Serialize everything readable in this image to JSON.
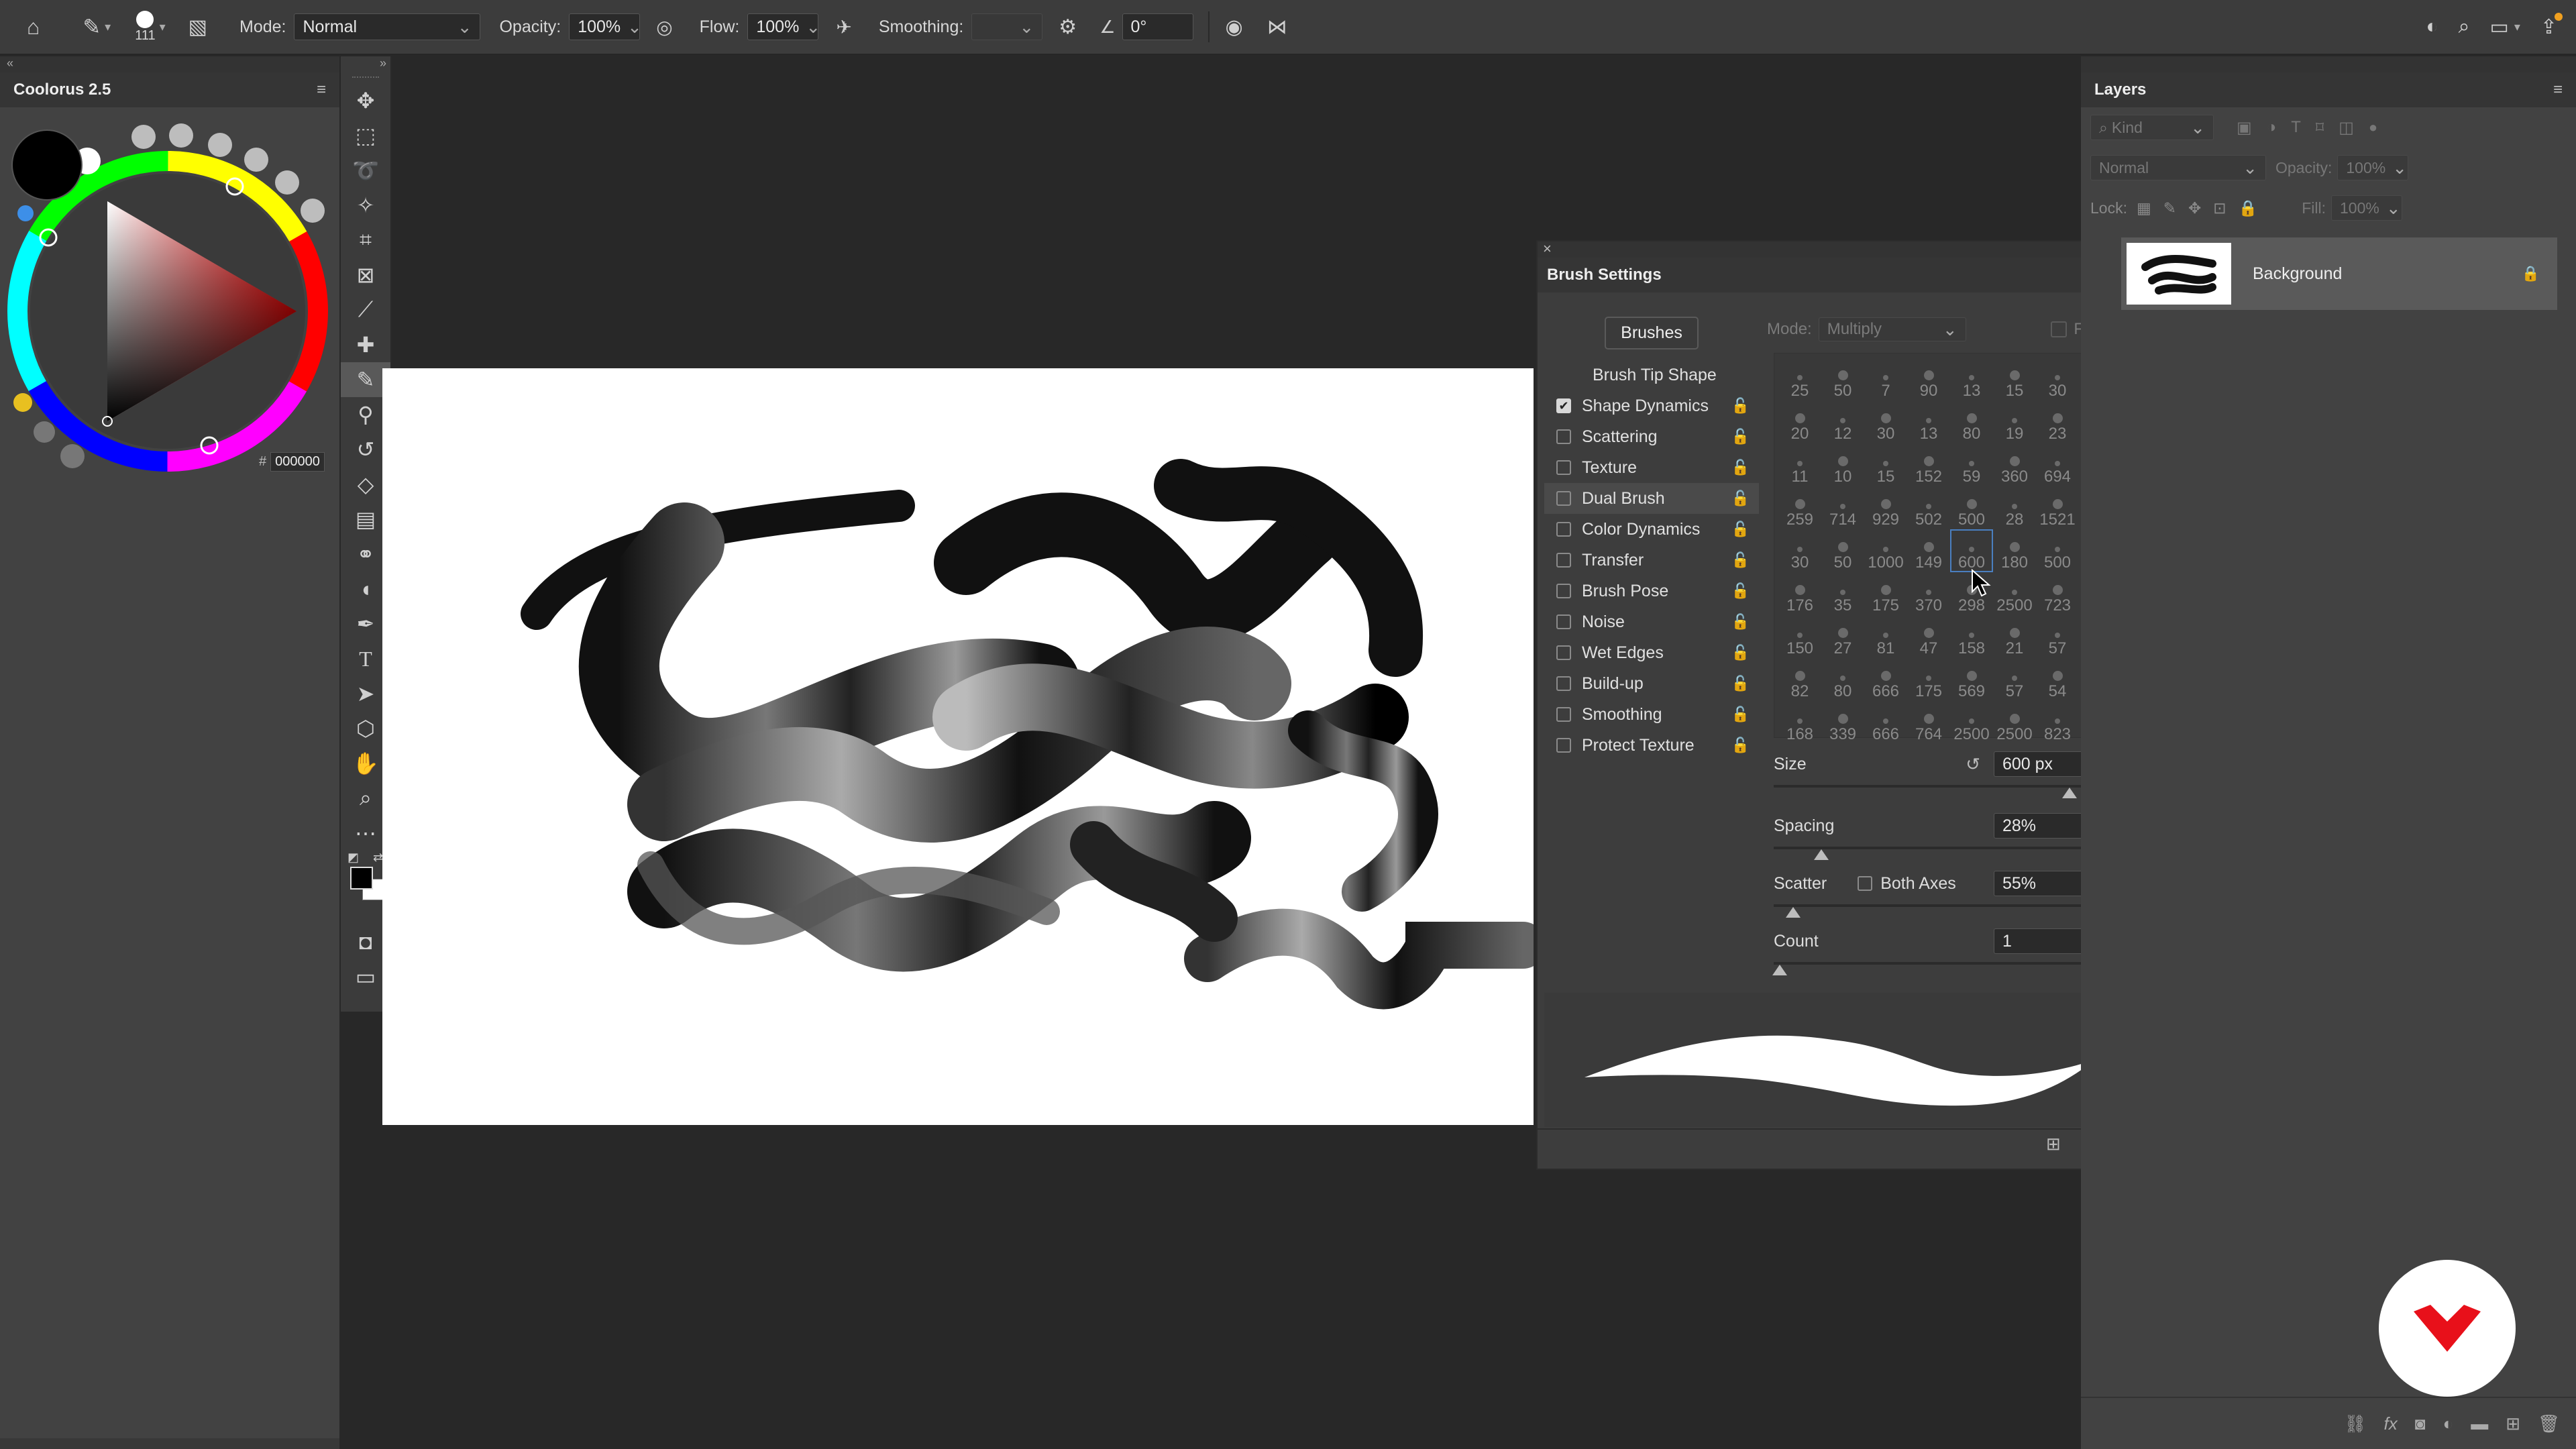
{
  "options_bar": {
    "brush_size": "111",
    "mode_label": "Mode:",
    "mode_value": "Normal",
    "opacity_label": "Opacity:",
    "opacity_value": "100%",
    "flow_label": "Flow:",
    "flow_value": "100%",
    "smoothing_label": "Smoothing:",
    "smoothing_value": "",
    "angle_value": "0°"
  },
  "colour_panel": {
    "title": "Coolorus 2.5",
    "hex_prefix": "#",
    "hex_value": "000000"
  },
  "brush_settings": {
    "title": "Brush Settings",
    "brushes_button": "Brushes",
    "mode_label": "Mode:",
    "mode_value": "Multiply",
    "flip_label": "Flip",
    "tip_shape": "Brush Tip Shape",
    "options": [
      {
        "label": "Shape Dynamics",
        "checked": true
      },
      {
        "label": "Scattering",
        "checked": false
      },
      {
        "label": "Texture",
        "checked": false
      },
      {
        "label": "Dual Brush",
        "checked": false
      },
      {
        "label": "Color Dynamics",
        "checked": false
      },
      {
        "label": "Transfer",
        "checked": false
      },
      {
        "label": "Brush Pose",
        "checked": false
      },
      {
        "label": "Noise",
        "checked": false
      },
      {
        "label": "Wet Edges",
        "checked": false
      },
      {
        "label": "Build-up",
        "checked": false
      },
      {
        "label": "Smoothing",
        "checked": false
      },
      {
        "label": "Protect Texture",
        "checked": false
      }
    ],
    "presets": [
      "25",
      "50",
      "7",
      "90",
      "13",
      "15",
      "30",
      "20",
      "12",
      "30",
      "13",
      "80",
      "19",
      "23",
      "11",
      "10",
      "15",
      "152",
      "59",
      "360",
      "694",
      "259",
      "714",
      "929",
      "502",
      "500",
      "28",
      "1521",
      "30",
      "50",
      "1000",
      "149",
      "600",
      "180",
      "500",
      "176",
      "35",
      "175",
      "370",
      "298",
      "2500",
      "723",
      "150",
      "27",
      "81",
      "47",
      "158",
      "21",
      "57",
      "82",
      "80",
      "666",
      "175",
      "569",
      "57",
      "54",
      "168",
      "339",
      "666",
      "764",
      "2500",
      "2500",
      "823"
    ],
    "selected_preset_index": 32,
    "size_label": "Size",
    "size_value": "600 px",
    "spacing_label": "Spacing",
    "spacing_value": "28%",
    "scatter_label": "Scatter",
    "both_axes_label": "Both Axes",
    "scatter_value": "55%",
    "count_label": "Count",
    "count_value": "1"
  },
  "layers_panel": {
    "title": "Layers",
    "kind_placeholder": "Kind",
    "blend_mode": "Normal",
    "opacity_label": "Opacity:",
    "opacity_value": "100%",
    "lock_label": "Lock:",
    "fill_label": "Fill:",
    "fill_value": "100%",
    "layer_name": "Background"
  },
  "colors": {
    "accent_red": "#e8101a",
    "foreground": "#000000",
    "background": "#ffffff"
  }
}
